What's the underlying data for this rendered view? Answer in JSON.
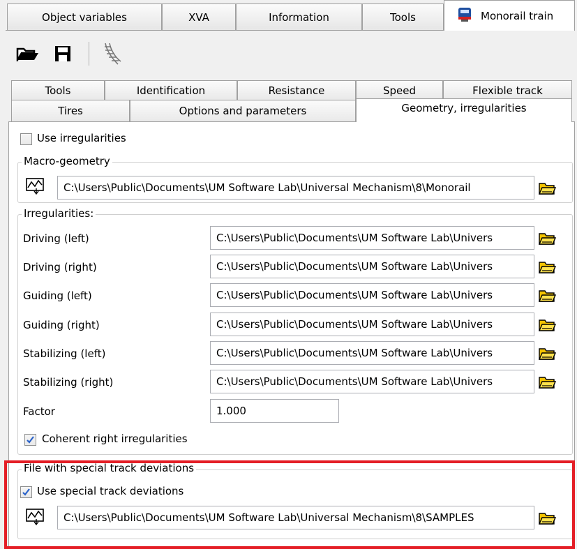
{
  "top_tabs": [
    {
      "label": "Object variables"
    },
    {
      "label": "XVA"
    },
    {
      "label": "Information"
    },
    {
      "label": "Tools"
    },
    {
      "label": "Monorail train"
    }
  ],
  "inner_tabs_row1": [
    "Tools",
    "Identification",
    "Resistance",
    "Speed",
    "Flexible track"
  ],
  "inner_tabs_row2": [
    "Tires",
    "Options and parameters",
    "Geometry, irregularities"
  ],
  "use_irregularities": {
    "label": "Use irregularities",
    "checked": false
  },
  "macro": {
    "legend": "Macro-geometry",
    "path": "C:\\Users\\Public\\Documents\\UM Software Lab\\Universal Mechanism\\8\\Monorail"
  },
  "irregularities": {
    "legend": "Irregularities:",
    "rows": [
      {
        "label": "Driving (left)",
        "path": "C:\\Users\\Public\\Documents\\UM Software Lab\\Univers"
      },
      {
        "label": "Driving (right)",
        "path": "C:\\Users\\Public\\Documents\\UM Software Lab\\Univers"
      },
      {
        "label": "Guiding (left)",
        "path": "C:\\Users\\Public\\Documents\\UM Software Lab\\Univers"
      },
      {
        "label": "Guiding (right)",
        "path": "C:\\Users\\Public\\Documents\\UM Software Lab\\Univers"
      },
      {
        "label": "Stabilizing (left)",
        "path": "C:\\Users\\Public\\Documents\\UM Software Lab\\Univers"
      },
      {
        "label": "Stabilizing (right)",
        "path": "C:\\Users\\Public\\Documents\\UM Software Lab\\Univers"
      }
    ],
    "factor_label": "Factor",
    "factor_value": "1.000",
    "coherent": {
      "label": "Coherent right irregularities",
      "checked": true
    }
  },
  "special": {
    "legend": "File with special track deviations",
    "use": {
      "label": "Use special track deviations",
      "checked": true
    },
    "path": "C:\\Users\\Public\\Documents\\UM Software Lab\\Universal Mechanism\\8\\SAMPLES"
  },
  "colors": {
    "highlight": "#e41e26",
    "train_icon": "#1f4fa0"
  }
}
